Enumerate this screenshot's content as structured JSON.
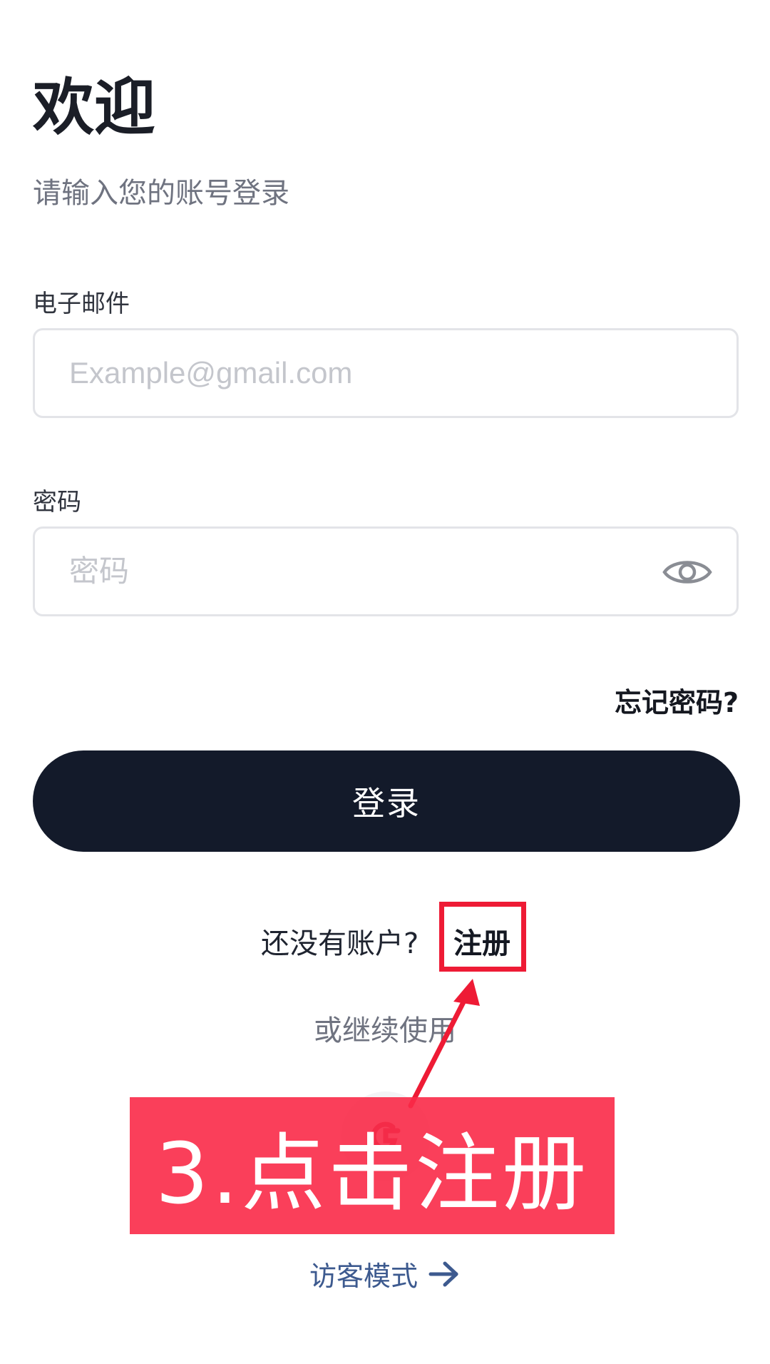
{
  "header": {
    "title": "欢迎",
    "subtitle": "请输入您的账号登录"
  },
  "form": {
    "email_label": "电子邮件",
    "email_placeholder": "Example@gmail.com",
    "email_value": "",
    "password_label": "密码",
    "password_placeholder": "密码",
    "password_value": "",
    "forgot_label": "忘记密码?",
    "login_label": "登录"
  },
  "register": {
    "prompt": "还没有账户?",
    "link_label": "注册"
  },
  "alt_login": {
    "continue_text": "或继续使用",
    "provider_icon": "google-icon"
  },
  "annotation": {
    "step_text": "3.点击注册",
    "highlight_color": "#ee1b35",
    "banner_color": "#fa2a48"
  },
  "guest": {
    "label": "访客模式"
  },
  "colors": {
    "primary_button": "#131a2a",
    "guest_link": "#3d5a8f"
  }
}
